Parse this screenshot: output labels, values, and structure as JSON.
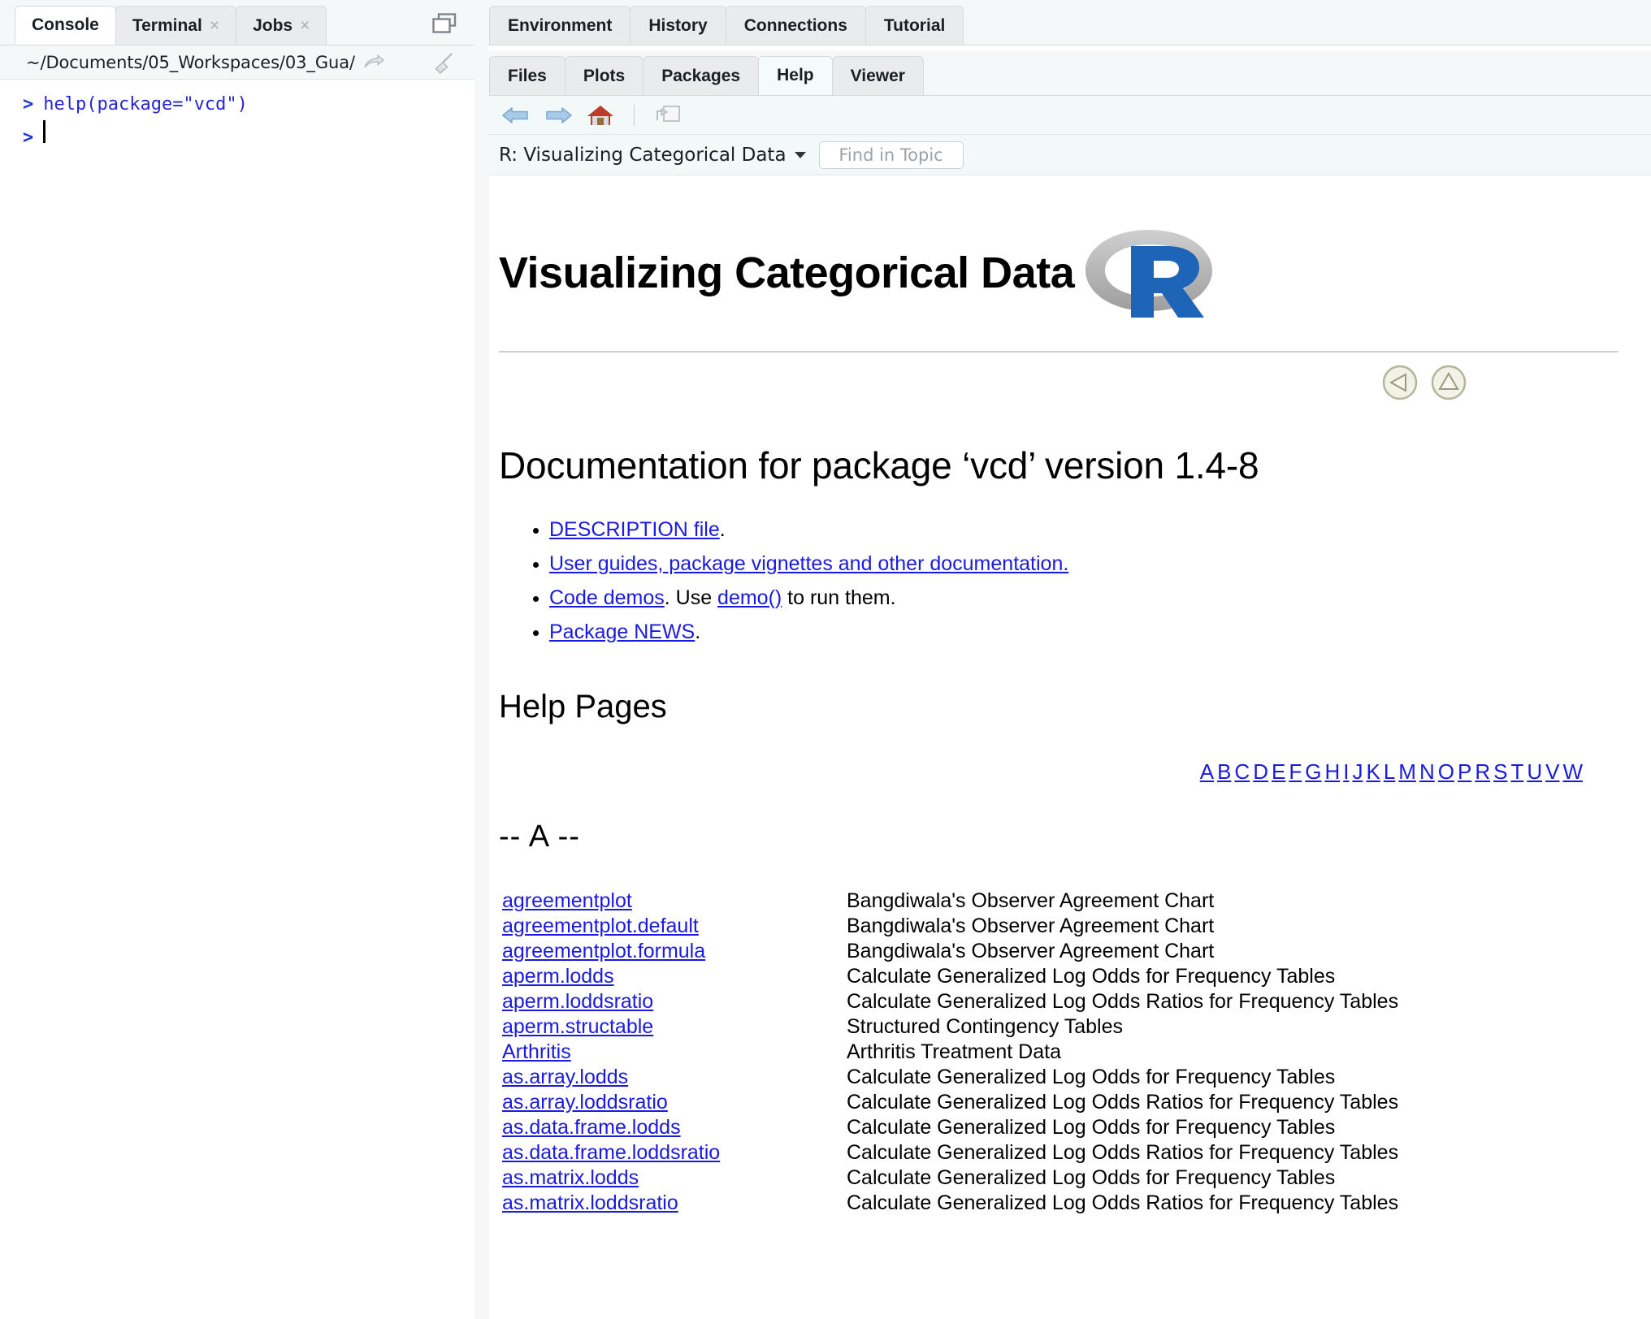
{
  "console": {
    "tabs": [
      {
        "label": "Console",
        "closable": false,
        "active": true
      },
      {
        "label": "Terminal",
        "closable": true,
        "active": false
      },
      {
        "label": "Jobs",
        "closable": true,
        "active": false
      }
    ],
    "close_glyph": "×",
    "path": "~/Documents/05_Workspaces/03_Gua/",
    "lines": [
      {
        "prompt": ">",
        "code": "help(package=\"vcd\")"
      },
      {
        "prompt": ">",
        "code": ""
      }
    ],
    "icons": {
      "pane_layout": "pane-layout-icon",
      "open_in_window": "open-in-new-window-icon",
      "clear": "broom-clear-console-icon"
    }
  },
  "right_pane": {
    "upper_tabs": [
      {
        "label": "Environment",
        "active": false
      },
      {
        "label": "History",
        "active": false
      },
      {
        "label": "Connections",
        "active": false
      },
      {
        "label": "Tutorial",
        "active": false
      }
    ],
    "lower_tabs": [
      {
        "label": "Files",
        "active": false
      },
      {
        "label": "Plots",
        "active": false
      },
      {
        "label": "Packages",
        "active": false
      },
      {
        "label": "Help",
        "active": true
      },
      {
        "label": "Viewer",
        "active": false
      }
    ],
    "toolbar": {
      "back": "back-arrow-icon",
      "forward": "forward-arrow-icon",
      "home": "home-icon",
      "popout": "show-in-new-window-icon"
    },
    "findbar": {
      "topic_label": "R: Visualizing Categorical Data",
      "find_placeholder": "Find in Topic",
      "find_value": ""
    }
  },
  "document": {
    "title": "Visualizing Categorical Data",
    "logo": "r-logo-icon",
    "nav_circles": [
      {
        "name": "back-circle-icon",
        "direction": "left"
      },
      {
        "name": "up-circle-icon",
        "direction": "up"
      }
    ],
    "heading": "Documentation for package ‘vcd’ version 1.4-8",
    "bullets": [
      {
        "link": "DESCRIPTION file",
        "after": "."
      },
      {
        "link": "User guides, package vignettes and other documentation.",
        "after": ""
      },
      {
        "link": "Code demos",
        "mid": ". Use ",
        "link2": "demo()",
        "after": " to run them."
      },
      {
        "link": "Package NEWS",
        "after": "."
      }
    ],
    "help_pages_heading": "Help Pages",
    "alphabet": [
      "A",
      "B",
      "C",
      "D",
      "E",
      "F",
      "G",
      "H",
      "I",
      "J",
      "K",
      "L",
      "M",
      "N",
      "O",
      "P",
      "R",
      "S",
      "T",
      "U",
      "V",
      "W"
    ],
    "section_label": "-- A --",
    "entries": [
      {
        "name": "agreementplot",
        "desc": "Bangdiwala's Observer Agreement Chart"
      },
      {
        "name": "agreementplot.default",
        "desc": "Bangdiwala's Observer Agreement Chart"
      },
      {
        "name": "agreementplot.formula",
        "desc": "Bangdiwala's Observer Agreement Chart"
      },
      {
        "name": "aperm.lodds",
        "desc": "Calculate Generalized Log Odds for Frequency Tables"
      },
      {
        "name": "aperm.loddsratio",
        "desc": "Calculate Generalized Log Odds Ratios for Frequency Tables"
      },
      {
        "name": "aperm.structable",
        "desc": "Structured Contingency Tables"
      },
      {
        "name": "Arthritis",
        "desc": "Arthritis Treatment Data"
      },
      {
        "name": "as.array.lodds",
        "desc": "Calculate Generalized Log Odds for Frequency Tables"
      },
      {
        "name": "as.array.loddsratio",
        "desc": "Calculate Generalized Log Odds Ratios for Frequency Tables"
      },
      {
        "name": "as.data.frame.lodds",
        "desc": "Calculate Generalized Log Odds for Frequency Tables"
      },
      {
        "name": "as.data.frame.loddsratio",
        "desc": "Calculate Generalized Log Odds Ratios for Frequency Tables"
      },
      {
        "name": "as.matrix.lodds",
        "desc": "Calculate Generalized Log Odds for Frequency Tables"
      },
      {
        "name": "as.matrix.loddsratio",
        "desc": "Calculate Generalized Log Odds Ratios for Frequency Tables"
      }
    ]
  },
  "colors": {
    "link": "#1a1ae0",
    "console_code": "#2626d6",
    "r_logo_blue": "#1f65b7",
    "r_logo_grey": "#b8b8b8",
    "toolbar_bg": "#f2f9f8",
    "tab_inactive_bg": "#e9ebed"
  }
}
